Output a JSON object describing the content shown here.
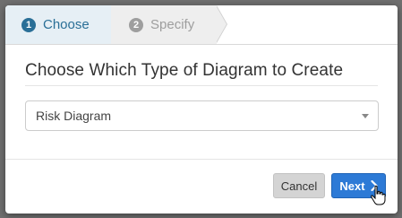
{
  "wizard": {
    "steps": [
      {
        "number": "1",
        "label": "Choose"
      },
      {
        "number": "2",
        "label": "Specify"
      }
    ]
  },
  "dialog": {
    "title": "Choose Which Type of Diagram to Create",
    "select": {
      "value": "Risk Diagram"
    }
  },
  "buttons": {
    "cancel": "Cancel",
    "next": "Next"
  },
  "colors": {
    "active_step": "#2a6f97",
    "primary_button": "#2d7ad6"
  }
}
